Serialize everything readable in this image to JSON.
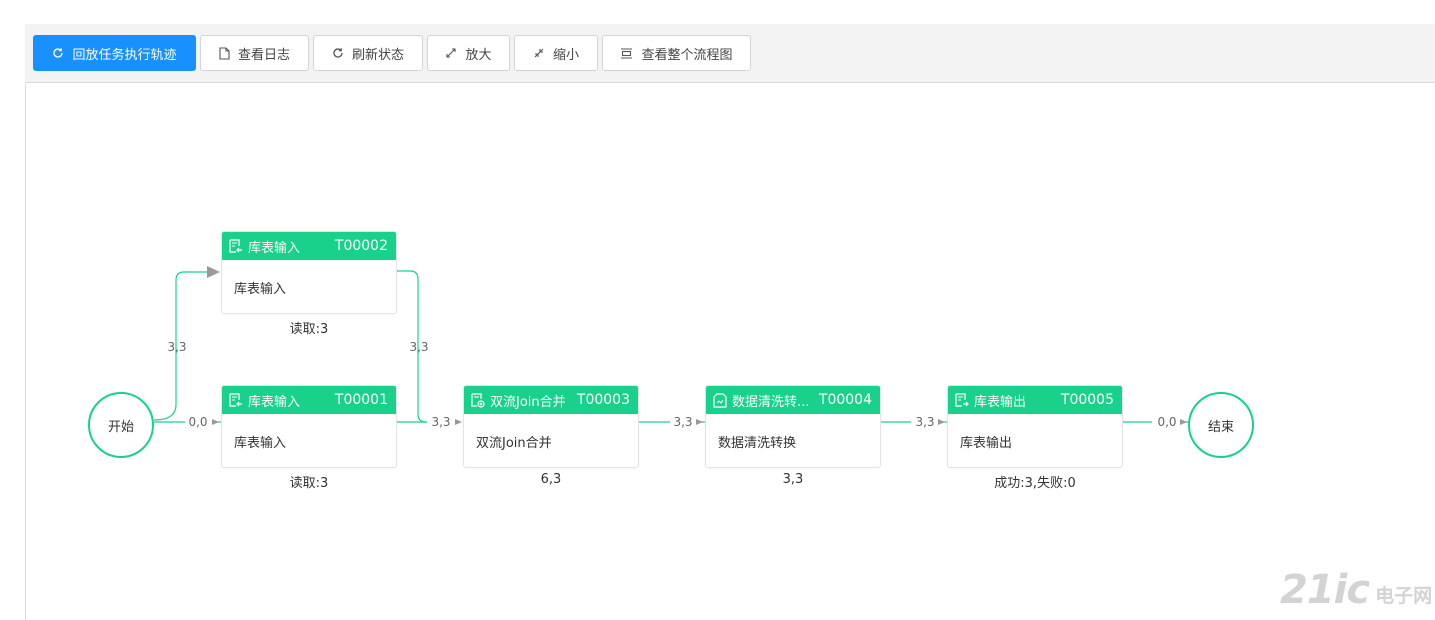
{
  "toolbar": {
    "buttons": [
      {
        "label": "回放任务执行轨迹",
        "icon": "refresh-icon"
      },
      {
        "label": "查看日志",
        "icon": "file-icon"
      },
      {
        "label": "刷新状态",
        "icon": "refresh-icon"
      },
      {
        "label": "放大",
        "icon": "expand-icon"
      },
      {
        "label": "缩小",
        "icon": "shrink-icon"
      },
      {
        "label": "查看整个流程图",
        "icon": "fit-view-icon"
      }
    ]
  },
  "flow": {
    "start": {
      "label": "开始"
    },
    "end": {
      "label": "结束"
    },
    "nodes": [
      {
        "title": "库表输入",
        "code": "T00002",
        "body": "库表输入",
        "stat": "读取:3"
      },
      {
        "title": "库表输入",
        "code": "T00001",
        "body": "库表输入",
        "stat": "读取:3"
      },
      {
        "title": "双流Join合并",
        "code": "T00003",
        "body": "双流Join合并",
        "stat": "6,3"
      },
      {
        "title": "数据清洗转...",
        "code": "T00004",
        "body": "数据清洗转换",
        "stat": "3,3"
      },
      {
        "title": "库表输出",
        "code": "T00005",
        "body": "库表输出",
        "stat": "成功:3,失败:0"
      }
    ],
    "edges": [
      {
        "label": "3,3"
      },
      {
        "label": "0,0"
      },
      {
        "label": "3,3"
      },
      {
        "label": "3,3"
      },
      {
        "label": "3,3"
      },
      {
        "label": "3,3"
      },
      {
        "label": "0,0"
      }
    ]
  },
  "colors": {
    "accent": "#19d18b",
    "primary": "#1890ff"
  },
  "watermark": {
    "big": "21ic",
    "small": "电子网"
  }
}
